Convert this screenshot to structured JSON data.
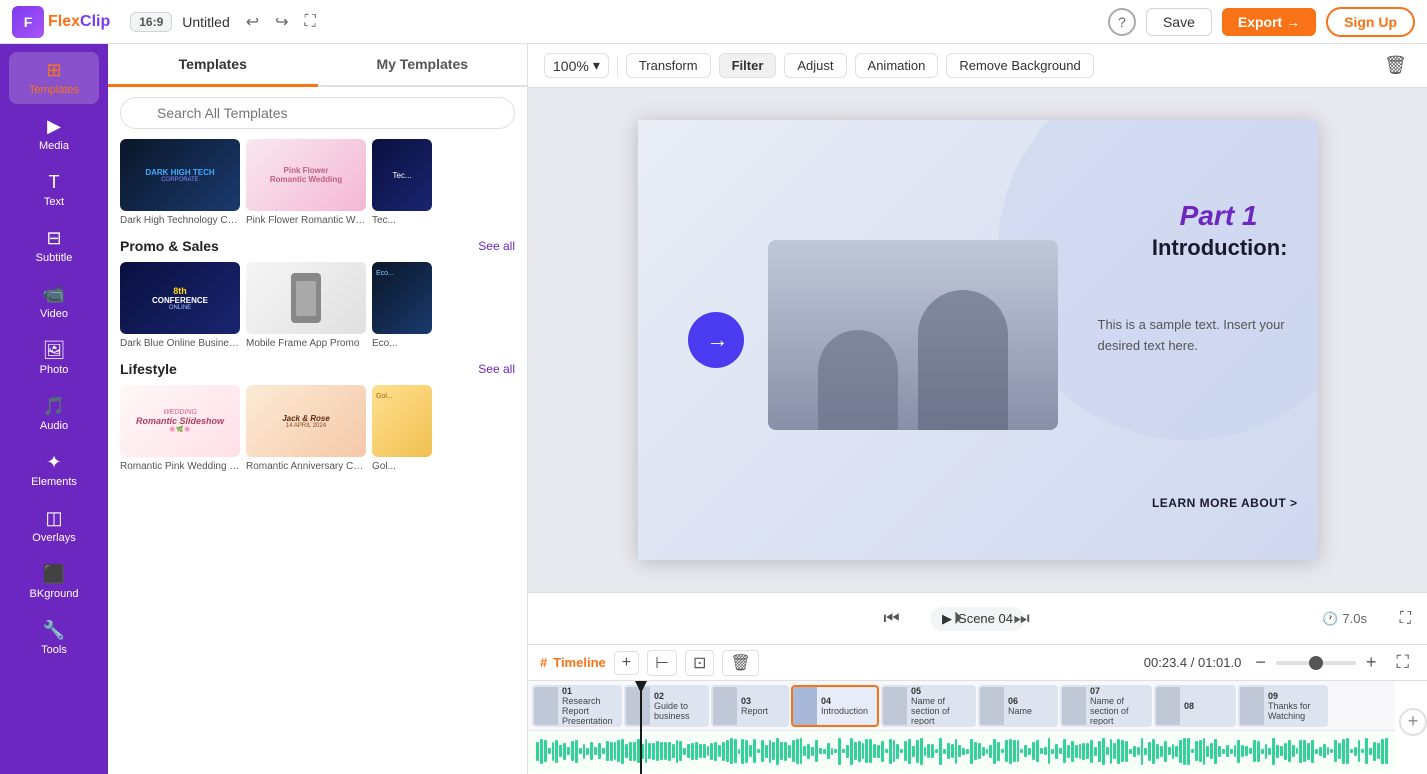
{
  "logo": {
    "text": "Flex",
    "text2": "Clip"
  },
  "topbar": {
    "ratio": "16:9",
    "title": "Untitled",
    "save_label": "Save",
    "export_label": "Export →",
    "signup_label": "Sign Up"
  },
  "sidebar": {
    "items": [
      {
        "id": "templates",
        "label": "Templates",
        "icon": "⊞",
        "active": true
      },
      {
        "id": "media",
        "label": "Media",
        "icon": "▶"
      },
      {
        "id": "text",
        "label": "Text",
        "icon": "T"
      },
      {
        "id": "subtitle",
        "label": "Subtitle",
        "icon": "⊟"
      },
      {
        "id": "video",
        "label": "Video",
        "icon": "🎬"
      },
      {
        "id": "photo",
        "label": "Photo",
        "icon": "🖼"
      },
      {
        "id": "audio",
        "label": "Audio",
        "icon": "🎵"
      },
      {
        "id": "elements",
        "label": "Elements",
        "icon": "✦"
      },
      {
        "id": "overlays",
        "label": "Overlays",
        "icon": "◫"
      },
      {
        "id": "bkground",
        "label": "BKground",
        "icon": "⬛"
      },
      {
        "id": "tools",
        "label": "Tools",
        "icon": "🔧"
      }
    ]
  },
  "panel": {
    "tab1": "Templates",
    "tab2": "My Templates",
    "search_placeholder": "Search All Templates",
    "sections": [
      {
        "title": "Promo & Sales",
        "see_all": "See all",
        "templates": [
          {
            "label": "Dark Blue Online Business Confe...",
            "style": "conf"
          },
          {
            "label": "Mobile Frame App Promo",
            "style": "mobile-frame"
          },
          {
            "label": "Eco...",
            "style": "dark-blue"
          }
        ]
      },
      {
        "title": "Lifestyle",
        "see_all": "See all",
        "templates": [
          {
            "label": "Romantic Pink Wedding Slidesh...",
            "style": "romantic-pink"
          },
          {
            "label": "Romantic Anniversary Collage Sl...",
            "style": "anniversary"
          },
          {
            "label": "Gol...",
            "style": "pink-flower"
          }
        ]
      }
    ],
    "top_templates": [
      {
        "label": "Dark High Technology Corporate...",
        "style": "dark-blue"
      },
      {
        "label": "Pink Flower Romantic Wedding ...",
        "style": "pink-flower"
      },
      {
        "label": "Tec...",
        "style": "conf"
      }
    ]
  },
  "toolbar": {
    "zoom": "100%",
    "transform": "Transform",
    "filter": "Filter",
    "adjust": "Adjust",
    "animation": "Animation",
    "remove_bg": "Remove Background"
  },
  "canvas": {
    "part_text": "Part 1",
    "intro_text": "Introduction:",
    "sample_text": "This is a sample text. Insert your desired text here.",
    "learn_more": "LEARN MORE ABOUT >"
  },
  "controls": {
    "scene_label": "Scene 04",
    "time_current": "00:23.4",
    "time_total": "01:01.0",
    "duration": "7.0s"
  },
  "timeline": {
    "label": "Timeline",
    "time_display": "00:23.4 / 01:01.0",
    "clips": [
      {
        "id": "01",
        "text": "Research Report Presentation",
        "width": 90
      },
      {
        "id": "02",
        "text": "Guide to business",
        "width": 85
      },
      {
        "id": "03",
        "text": "Report",
        "width": 78
      },
      {
        "id": "04",
        "text": "Introduction",
        "width": 88,
        "active": true
      },
      {
        "id": "05",
        "text": "Name of section of report",
        "width": 95
      },
      {
        "id": "06",
        "text": "Name",
        "width": 80
      },
      {
        "id": "07",
        "text": "Name of section of report",
        "width": 92
      },
      {
        "id": "08",
        "text": "",
        "width": 82
      },
      {
        "id": "09",
        "text": "Thanks for Watching",
        "width": 90
      }
    ]
  }
}
